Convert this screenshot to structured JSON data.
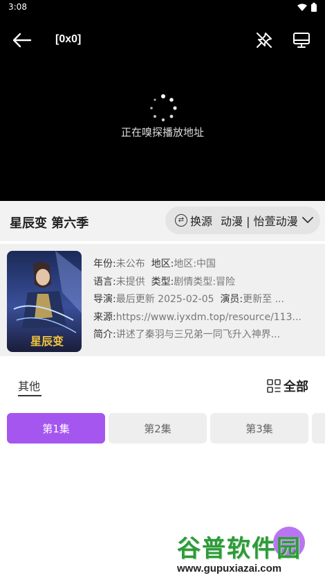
{
  "status": {
    "time": "3:08"
  },
  "player": {
    "title": "[0x0]",
    "loading_text": "正在嗅探播放地址"
  },
  "show": {
    "title": "星辰变 第六季"
  },
  "source": {
    "switch_label": "换源",
    "name": "动漫 | 怡萱动漫"
  },
  "info": {
    "year_label": "年份:",
    "year": "未公布",
    "region_label": "地区:",
    "region": "地区:中国",
    "lang_label": "语言:",
    "lang": "未提供",
    "type_label": "类型:",
    "type": "剧情类型:冒险",
    "director_label": "导演:",
    "director": "最后更新 2025-02-05",
    "cast_label": "演员:",
    "cast": "更新至 ...",
    "source_label": "来源:",
    "source_url": "https://www.iyxdm.top/resource/113...",
    "intro_label": "简介:",
    "intro": "讲述了秦羽与三兄弟一同飞升入神界..."
  },
  "episodes": {
    "tab_label": "其他",
    "all_label": "全部",
    "items": [
      "第1集",
      "第2集",
      "第3集"
    ]
  },
  "watermark": {
    "main": "谷普软件园",
    "sub": "www.gupuxiazai.com"
  },
  "colors": {
    "accent": "#a556ef",
    "player_bg": "#000000"
  }
}
